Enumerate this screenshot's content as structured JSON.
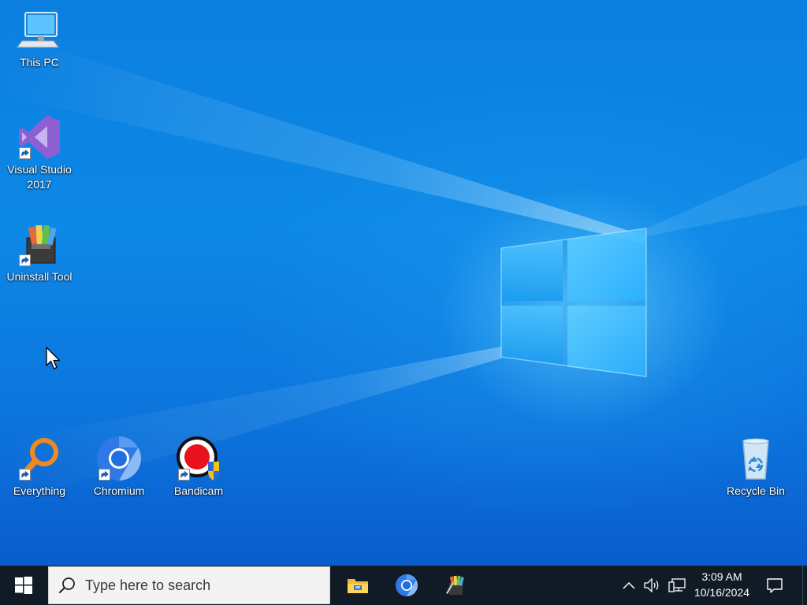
{
  "desktop": {
    "icons": [
      {
        "label": "This PC",
        "icon": "this-pc-icon"
      },
      {
        "label": "Visual Studio\n2017",
        "icon": "visual-studio-icon"
      },
      {
        "label": "Uninstall Tool",
        "icon": "uninstall-tool-icon"
      },
      {
        "label": "Everything",
        "icon": "everything-icon"
      },
      {
        "label": "Chromium",
        "icon": "chromium-icon"
      },
      {
        "label": "Bandicam",
        "icon": "bandicam-icon"
      },
      {
        "label": "Recycle Bin",
        "icon": "recycle-bin-icon"
      }
    ]
  },
  "taskbar": {
    "search_placeholder": "Type here to search",
    "pinned_apps": [
      "file-explorer-icon",
      "chromium-icon",
      "uninstall-tool-icon"
    ],
    "clock": {
      "time": "3:09 AM",
      "date": "10/16/2024"
    },
    "tray_icons": [
      "chevron-up-icon",
      "speaker-icon",
      "network-icon",
      "notification-icon"
    ]
  },
  "colors": {
    "wallpaper_blue": "#0b7fe0",
    "taskbar": "#101b26",
    "search_box": "#f3f3f3"
  }
}
